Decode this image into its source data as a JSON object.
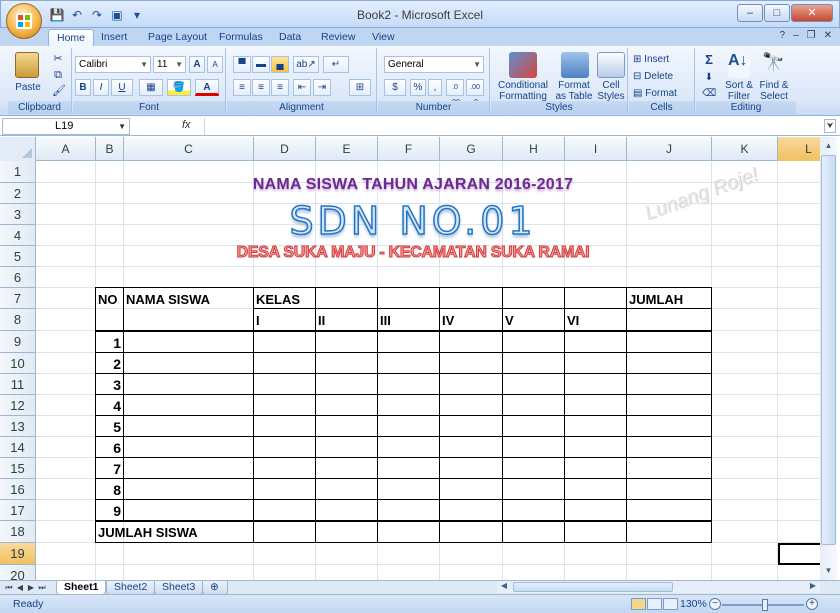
{
  "window": {
    "title": "Book2 - Microsoft Excel",
    "controls": {
      "minimize": "–",
      "maximize": "□",
      "close": "✕"
    }
  },
  "qat": {
    "save": "💾",
    "undo": "↶",
    "redo": "↷",
    "print_preview": "▣",
    "customize": "▾"
  },
  "ribbon": {
    "tabs": [
      "Home",
      "Insert",
      "Page Layout",
      "Formulas",
      "Data",
      "Review",
      "View"
    ],
    "active_tab": "Home",
    "help": "?",
    "doc_controls": {
      "minimize": "–",
      "restore": "❐",
      "close": "✕"
    },
    "clipboard": {
      "label": "Clipboard",
      "paste": "Paste"
    },
    "font": {
      "label": "Font",
      "name": "Calibri",
      "size": "11",
      "bold": "B",
      "italic": "I",
      "underline": "U",
      "grow": "A",
      "shrink": "A",
      "font_color": "A"
    },
    "alignment": {
      "label": "Alignment"
    },
    "number": {
      "label": "Number",
      "format": "General",
      "currency": "$",
      "percent": "%",
      "comma": ",",
      "inc_dec": ".0 .00",
      "dec_dec": ".00 .0"
    },
    "styles": {
      "label": "Styles",
      "conditional": "Conditional Formatting",
      "format_table": "Format as Table",
      "cell_styles": "Cell Styles"
    },
    "cells": {
      "label": "Cells",
      "insert": "Insert",
      "delete": "Delete",
      "format": "Format"
    },
    "editing": {
      "label": "Editing",
      "sum": "Σ",
      "sort": "Sort & Filter",
      "find": "Find & Select"
    }
  },
  "formula_bar": {
    "name_box": "L19",
    "fx": "fx",
    "content": ""
  },
  "columns": [
    "A",
    "B",
    "C",
    "D",
    "E",
    "F",
    "G",
    "H",
    "I",
    "J",
    "K",
    "L"
  ],
  "rows": [
    "1",
    "2",
    "3",
    "4",
    "5",
    "6",
    "7",
    "8",
    "9",
    "10",
    "11",
    "12",
    "13",
    "14",
    "15",
    "16",
    "17",
    "18",
    "19",
    "20"
  ],
  "sheet": {
    "title_line": "NAMA SISWA TAHUN AJARAN 2016-2017",
    "school": "SDN NO.01",
    "address": "DESA SUKA MAJU - KECAMATAN SUKA RAMAI",
    "watermark": "Lunang Roje!",
    "headers": {
      "no": "NO",
      "nama": "NAMA SISWA",
      "kelas": "KELAS",
      "jumlah": "JUMLAH"
    },
    "kelas_levels": [
      "I",
      "II",
      "III",
      "IV",
      "V",
      "VI"
    ],
    "numbers": [
      "1",
      "2",
      "3",
      "4",
      "5",
      "6",
      "7",
      "8",
      "9"
    ],
    "total_label": "JUMLAH SISWA"
  },
  "sheet_tabs": [
    "Sheet1",
    "Sheet2",
    "Sheet3"
  ],
  "active_sheet": "Sheet1",
  "status": {
    "ready": "Ready",
    "zoom": "130%"
  }
}
